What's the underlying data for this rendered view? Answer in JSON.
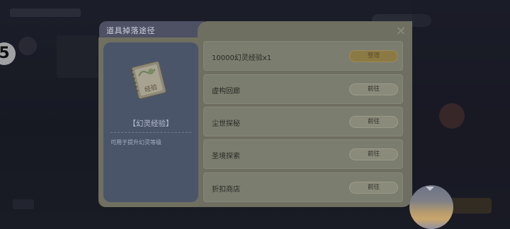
{
  "dialog": {
    "title": "道具掉落途径",
    "close_icon": "close-icon"
  },
  "item": {
    "name": "【幻灵经验】",
    "description": "可用于提升幻灵等级",
    "icon": "experience-book-icon",
    "image_label": "经验"
  },
  "sources": [
    {
      "label": "10000幻灵经验x1",
      "button": "整理",
      "style": "gold"
    },
    {
      "label": "虚构回廊",
      "button": "前往",
      "style": "normal"
    },
    {
      "label": "尘世探秘",
      "button": "前往",
      "style": "normal"
    },
    {
      "label": "圣境探索",
      "button": "前往",
      "style": "normal"
    },
    {
      "label": "折扣商店",
      "button": "前往",
      "style": "normal"
    }
  ],
  "side_badge": "5",
  "colors": {
    "panel": "#6e6f60",
    "row": "#7b7d6e",
    "card": "#4b556a",
    "header": "#4e5164",
    "gold_button": "#8c7a45"
  }
}
